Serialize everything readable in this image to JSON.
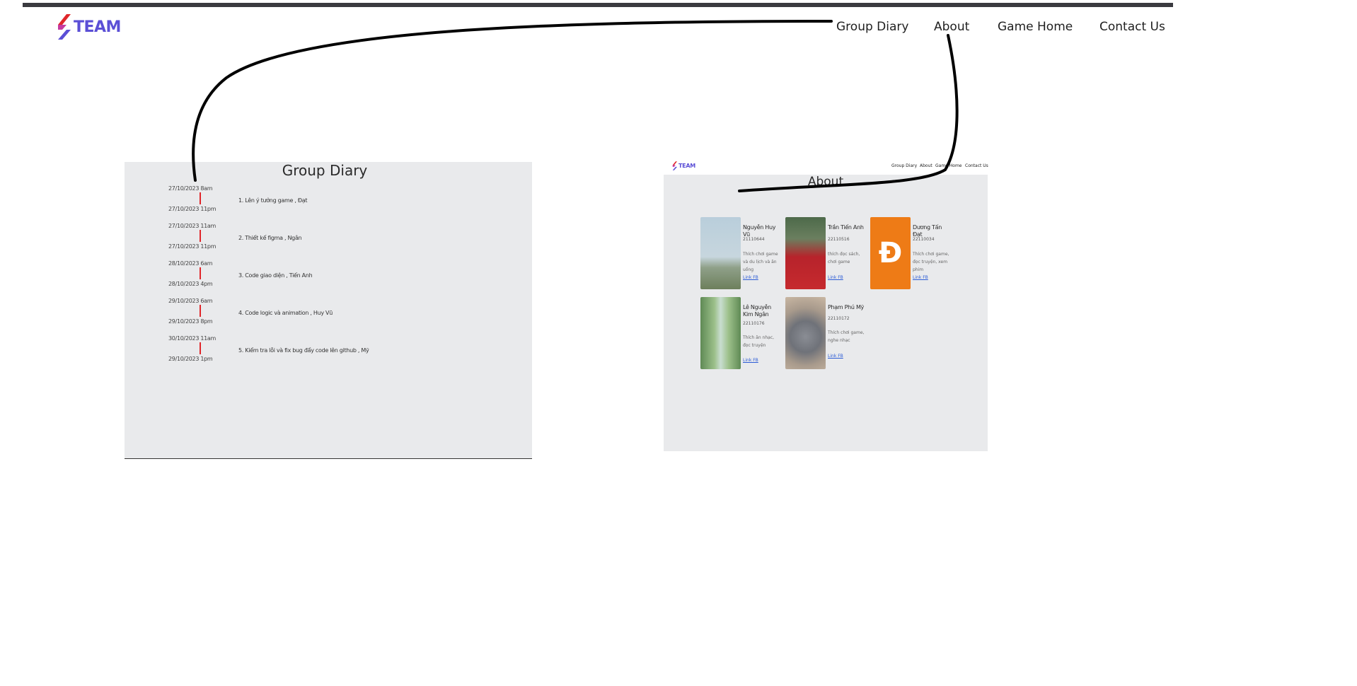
{
  "brand": {
    "name": "TEAM",
    "accent": "#5b4fd6",
    "mark_colors": [
      "#e0262a",
      "#5b4fd6"
    ]
  },
  "nav": {
    "items": [
      {
        "label": "Group Diary"
      },
      {
        "label": "About"
      },
      {
        "label": "Game Home"
      },
      {
        "label": "Contact Us"
      }
    ]
  },
  "diary": {
    "title": "Group Diary",
    "entries": [
      {
        "start": "27/10/2023 8am",
        "end": "27/10/2023 11pm",
        "text": "1. Lên ý tưởng game , Đạt"
      },
      {
        "start": "27/10/2023 11am",
        "end": "27/10/2023 11pm",
        "text": "2. Thiết kế figma , Ngân"
      },
      {
        "start": "28/10/2023 6am",
        "end": "28/10/2023 4pm",
        "text": "3. Code giao diện , Tiến Anh"
      },
      {
        "start": "29/10/2023 6am",
        "end": "29/10/2023 8pm",
        "text": "4. Code logic và animation , Huy Vũ"
      },
      {
        "start": "30/10/2023 11am",
        "end": "29/10/2023 1pm",
        "text": "5. Kiểm tra lỗi và fix bug đẩy code lên github , Mỹ"
      }
    ]
  },
  "about": {
    "mini_brand": "TEAM",
    "mini_nav": [
      "Group Diary",
      "About",
      "Game Home",
      "Contact Us"
    ],
    "title": "About",
    "members": [
      {
        "name": "Nguyễn Huy Vũ",
        "id": "21110644",
        "bio": "Thích chơi game và du lịch và ăn uống",
        "link": "Link FB",
        "photo": "sky-photo"
      },
      {
        "name": "Trần Tiến Anh",
        "id": "22110516",
        "bio": "thích đọc sách, chơi game",
        "link": "Link FB",
        "photo": "red-shirt-photo"
      },
      {
        "name": "Dương Tấn Đạt",
        "id": "22110034",
        "bio": "Thích chơi game, đọc truyện, xem phim",
        "link": "Link FB",
        "photo": "letter-avatar",
        "avatar_letter": "Đ",
        "avatar_color": "#ee7b16"
      },
      {
        "name": "Lê Nguyễn Kim Ngân",
        "id": "22110176",
        "bio": "Thích ăn nhạc, đọc truyện",
        "link": "Link FB",
        "photo": "garden-photo"
      },
      {
        "name": "Phạm Phú Mỹ",
        "id": "22110172",
        "bio": "Thích chơi game, nghe nhạc",
        "link": "Link FB",
        "photo": "cat-photo"
      }
    ]
  },
  "annotation": {
    "stroke_color": "#000000"
  }
}
